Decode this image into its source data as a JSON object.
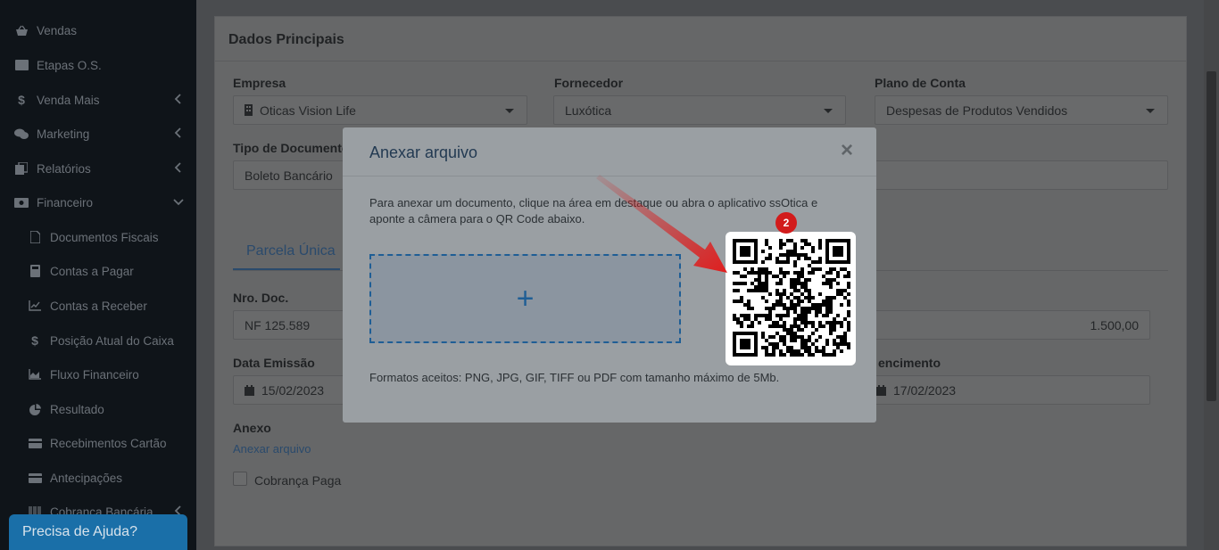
{
  "sidebar": {
    "items": [
      {
        "label": "Vendas",
        "icon": "basket-icon",
        "chevron": ""
      },
      {
        "label": "Etapas O.S.",
        "icon": "card-icon",
        "chevron": ""
      },
      {
        "label": "Venda Mais",
        "icon": "dollar-icon",
        "chevron": "left"
      },
      {
        "label": "Marketing",
        "icon": "chat-icon",
        "chevron": "left"
      },
      {
        "label": "Relatórios",
        "icon": "copy-icon",
        "chevron": "left"
      },
      {
        "label": "Financeiro",
        "icon": "money-icon",
        "chevron": "down"
      }
    ],
    "subitems": [
      {
        "label": "Documentos Fiscais",
        "icon": "file-icon"
      },
      {
        "label": "Contas a Pagar",
        "icon": "calculator-icon"
      },
      {
        "label": "Contas a Receber",
        "icon": "line-chart-icon"
      },
      {
        "label": "Posição Atual do Caixa",
        "icon": "dollar-icon"
      },
      {
        "label": "Fluxo Financeiro",
        "icon": "area-chart-icon"
      },
      {
        "label": "Resultado",
        "icon": "pie-chart-icon"
      },
      {
        "label": "Recebimentos Cartão",
        "icon": "credit-card-icon"
      },
      {
        "label": "Antecipações",
        "icon": "credit-card-icon"
      },
      {
        "label": "Cobrança Bancária",
        "icon": "barcode-icon"
      }
    ],
    "help_button": "Precisa de Ajuda?"
  },
  "form": {
    "section_title": "Dados Principais",
    "empresa_label": "Empresa",
    "empresa_value": "Oticas Vision Life",
    "fornecedor_label": "Fornecedor",
    "fornecedor_value": "Luxótica",
    "plano_label": "Plano de Conta",
    "plano_value": "Despesas de Produtos Vendidos",
    "tipo_label": "Tipo de Documento",
    "tipo_value": "Boleto Bancário",
    "tab_label": "Parcela Única",
    "nrodoc_label": "Nro. Doc.",
    "nrodoc_value": "NF 125.589",
    "valor_value": "1.500,00",
    "emissao_label": "Data Emissão",
    "emissao_value": "15/02/2023",
    "vencimento_label": "encimento",
    "vencimento_value": "17/02/2023",
    "anexo_label": "Anexo",
    "anexo_link": "Anexar arquivo",
    "cobranca_label": "Cobrança Paga"
  },
  "modal": {
    "title": "Anexar arquivo",
    "close": "×",
    "description": "Para anexar um documento, clique na área em destaque ou abra o aplicativo ssOtica e aponte a câmera para o QR Code abaixo.",
    "dropzone_plus": "+",
    "formats": "Formatos aceitos: PNG, JPG, GIF, TIFF ou PDF com tamanho máximo de 5Mb."
  },
  "annotation": {
    "badge": "2",
    "color": "#d21b1b"
  }
}
